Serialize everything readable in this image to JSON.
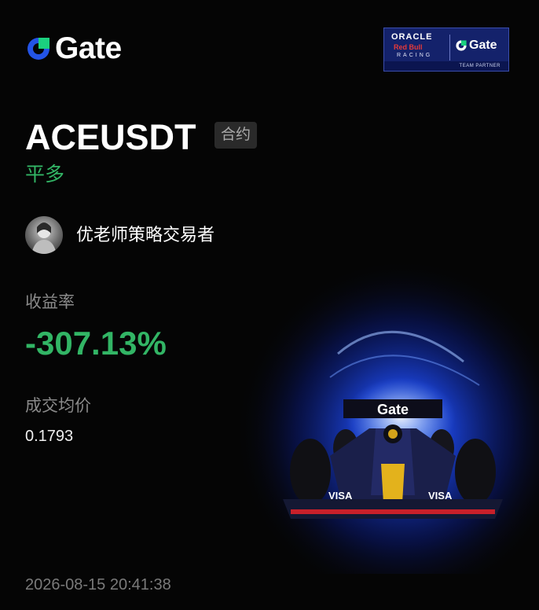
{
  "brand": {
    "name": "Gate",
    "logo_icon": "gate-logo-icon",
    "color": "#2354e6"
  },
  "partner": {
    "oracle": "ORACLE",
    "redbull": "Red Bull",
    "racing": "RACING",
    "gate": "Gate",
    "team": "TEAM PARTNER"
  },
  "position": {
    "pair": "ACEUSDT",
    "type_badge": "合约",
    "side": "平多"
  },
  "trader": {
    "avatar_icon": "trader-avatar",
    "name": "优老师策略交易者"
  },
  "metrics": {
    "roi_label": "收益率",
    "roi_value": "-307.13%",
    "price_label": "成交均价",
    "price_value": "0.1793"
  },
  "timestamp": "2026-08-15 20:41:38",
  "race_car": {
    "wing_text": "Gate",
    "sidepod_text": "VISA"
  },
  "colors": {
    "accent_green": "#32b565",
    "background": "#050505",
    "muted_text": "#8a8a8a"
  }
}
